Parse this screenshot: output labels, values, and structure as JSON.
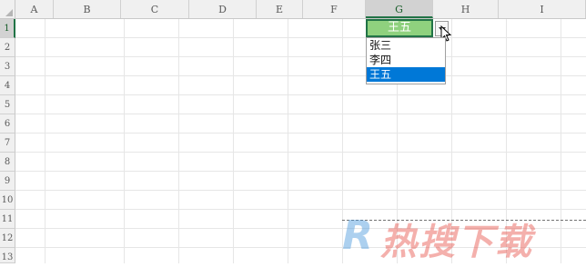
{
  "columns": [
    "A",
    "B",
    "C",
    "D",
    "E",
    "F",
    "G",
    "H",
    "I"
  ],
  "rows": [
    "1",
    "2",
    "3",
    "4",
    "5",
    "6",
    "7",
    "8",
    "9",
    "10",
    "11",
    "12",
    "13"
  ],
  "active_cell": {
    "column": "G",
    "row": "1",
    "value": "王五"
  },
  "dropdown": {
    "items": [
      "张三",
      "李四",
      "王五"
    ],
    "selected_index": 2
  },
  "watermark": {
    "brand_letter": "R",
    "text": "热搜下载"
  },
  "colors": {
    "active_fill": "#8fd17e",
    "active_border": "#217346",
    "selection_blue": "#0078d7"
  }
}
